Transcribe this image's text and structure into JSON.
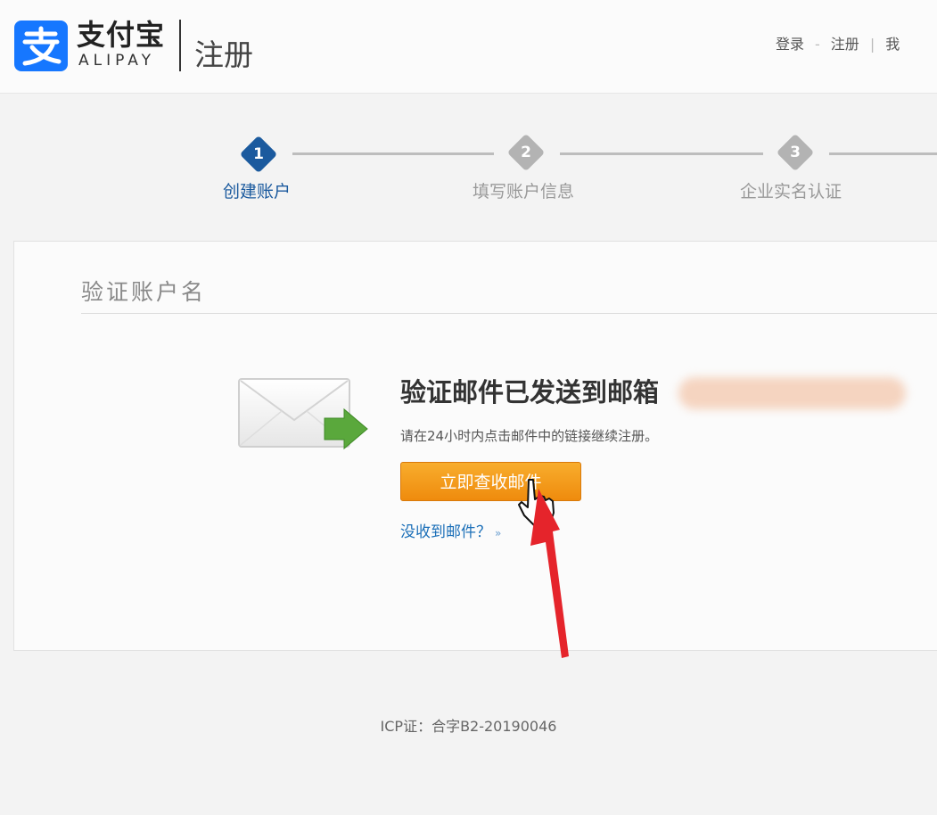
{
  "header": {
    "logo_cn": "支付宝",
    "logo_en": "ALIPAY",
    "page_title": "注册",
    "nav": {
      "login": "登录",
      "sep1": "-",
      "register": "注册",
      "sep2": "|",
      "mine": "我"
    }
  },
  "steps": [
    {
      "num": "1",
      "label": "创建账户",
      "state": "active"
    },
    {
      "num": "2",
      "label": "填写账户信息",
      "state": "pending"
    },
    {
      "num": "3",
      "label": "企业实名认证",
      "state": "pending"
    }
  ],
  "card": {
    "title": "验证账户名",
    "verify_title": "验证邮件已发送到邮箱",
    "verify_desc": "请在24小时内点击邮件中的链接继续注册。",
    "check_button": "立即查收邮件",
    "no_mail_link": "没收到邮件？",
    "no_mail_chevron": "»"
  },
  "footer": {
    "icp": "ICP证：合字B2-20190046"
  },
  "colors": {
    "brand_blue": "#1677ff",
    "active_step": "#1b5a9e",
    "button_orange": "#f59a1b",
    "link_blue": "#1b6fb8",
    "annotation_red": "#e5242b"
  },
  "icons": {
    "logo": "alipay-logo-icon",
    "envelope": "envelope-icon",
    "arrow": "green-arrow-icon",
    "cursor": "hand-cursor-icon",
    "annotation": "red-arrow-annotation"
  }
}
